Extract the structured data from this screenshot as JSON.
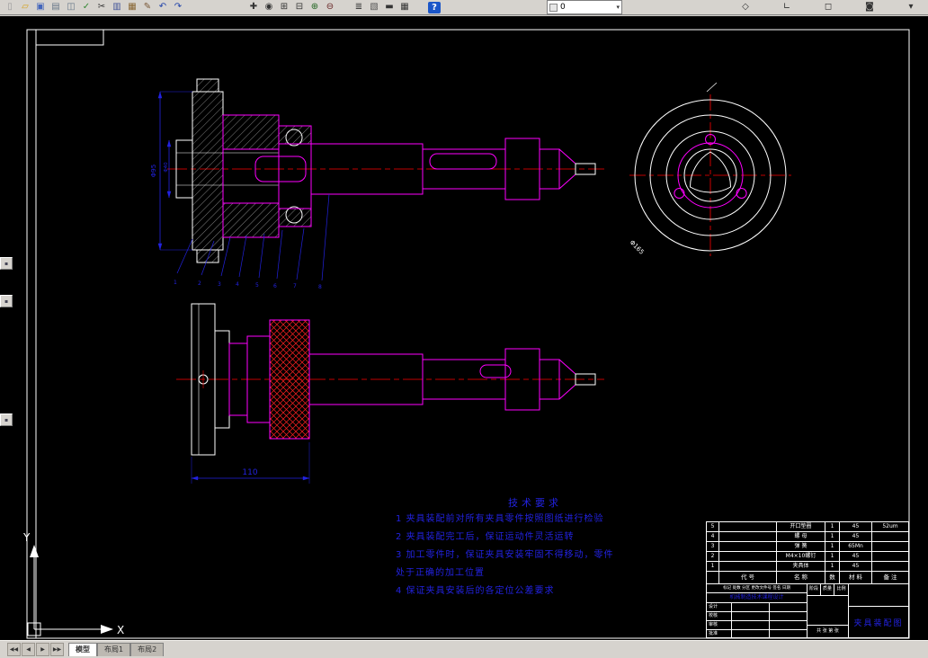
{
  "window": {
    "chrome_bg": "#d6d3ce",
    "canvas_bg": "#000000"
  },
  "colors": {
    "outline": "#ffffff",
    "part_edges": "#ff00ff",
    "centerline": "#ff0000",
    "dimension_blue": "#2222e0",
    "hatch_red": "#ff2020"
  },
  "toolbar": {
    "group1": [
      {
        "name": "new-file-button",
        "glyph": "▯",
        "color": "#9a9a9a"
      },
      {
        "name": "open-file-button",
        "glyph": "▱",
        "color": "#d4a017"
      },
      {
        "name": "save-button",
        "glyph": "▣",
        "color": "#4466bb"
      },
      {
        "name": "plot-button",
        "glyph": "▤",
        "color": "#667788"
      },
      {
        "name": "print-preview-button",
        "glyph": "◫",
        "color": "#667788"
      },
      {
        "name": "spell-check-button",
        "glyph": "✓",
        "color": "#338833"
      },
      {
        "name": "cut-button",
        "glyph": "✂",
        "color": "#333333"
      },
      {
        "name": "copy-button",
        "glyph": "▥",
        "color": "#445599"
      },
      {
        "name": "paste-button",
        "glyph": "▦",
        "color": "#886633"
      },
      {
        "name": "match-properties-button",
        "glyph": "✎",
        "color": "#775533"
      },
      {
        "name": "undo-button",
        "glyph": "↶",
        "color": "#2244aa"
      },
      {
        "name": "redo-button",
        "glyph": "↷",
        "color": "#2244aa"
      }
    ],
    "group2": [
      {
        "name": "pan-button",
        "glyph": "✚",
        "color": "#333333"
      },
      {
        "name": "zoom-realtime-button",
        "glyph": "◉",
        "color": "#333333"
      },
      {
        "name": "zoom-window-button",
        "glyph": "⊞",
        "color": "#333333"
      },
      {
        "name": "zoom-previous-button",
        "glyph": "⊟",
        "color": "#333333"
      },
      {
        "name": "zoom-in-button",
        "glyph": "⊕",
        "color": "#226622"
      },
      {
        "name": "zoom-out-button",
        "glyph": "⊖",
        "color": "#662222"
      }
    ],
    "group3": [
      {
        "name": "layers-button",
        "glyph": "≣",
        "color": "#333333"
      },
      {
        "name": "layer-states-button",
        "glyph": "▧",
        "color": "#555555"
      },
      {
        "name": "linetype-button",
        "glyph": "▬",
        "color": "#333333"
      },
      {
        "name": "table-button",
        "glyph": "▦",
        "color": "#333333"
      }
    ],
    "help": {
      "label": "?"
    },
    "layer_combo": {
      "value": "0"
    },
    "group4": [
      {
        "name": "osnap-button",
        "glyph": "◇",
        "color": "#333333"
      },
      {
        "name": "ucs-button",
        "glyph": "∟",
        "color": "#333333"
      },
      {
        "name": "views-button",
        "glyph": "◻",
        "color": "#333333"
      },
      {
        "name": "render-button",
        "glyph": "◙",
        "color": "#333333"
      },
      {
        "name": "toolbar-overflow-button",
        "glyph": "▾",
        "color": "#333333"
      }
    ],
    "docked_buttons": [
      "▪",
      "▪",
      "▪"
    ]
  },
  "drawing": {
    "dim_flange": "Φ95",
    "dim_spigot": "Φ40",
    "dim_circle": "Φ165",
    "dim_length": "110",
    "balloons": [
      "1",
      "2",
      "3",
      "4",
      "5",
      "6",
      "7",
      "8"
    ]
  },
  "notes": {
    "title": "技术要求",
    "lines": [
      "1  夹具装配前对所有夹具零件按照图纸进行检验",
      "2  夹具装配完工后，保证运动件灵活运转",
      "3  加工零件时，保证夹具安装牢固不得移动，零件",
      "    处于正确的加工位置",
      "4  保证夹具安装后的各定位公差要求"
    ]
  },
  "bom": {
    "header": {
      "no": "",
      "code": "代  号",
      "name": "名  称",
      "qty": "数",
      "mat": "材  料",
      "note": "备 注"
    },
    "rows": [
      {
        "no": "5",
        "code": "",
        "name": "开口垫圈",
        "qty": "1",
        "mat": "45",
        "note": "52um"
      },
      {
        "no": "4",
        "code": "",
        "name": "螺  母",
        "qty": "1",
        "mat": "45",
        "note": ""
      },
      {
        "no": "3",
        "code": "",
        "name": "弹  簧",
        "qty": "1",
        "mat": "65Mn",
        "note": ""
      },
      {
        "no": "2",
        "code": "",
        "name": "M4×10螺钉",
        "qty": "1",
        "mat": "45",
        "note": ""
      },
      {
        "no": "1",
        "code": "",
        "name": "夹具体",
        "qty": "1",
        "mat": "45",
        "note": ""
      }
    ]
  },
  "title_block": {
    "sig_header": "标记 处数 分区 更改文件号 签名 日期",
    "course": "机械制造技术课程设计",
    "row_labels": [
      "设计",
      "校核",
      "审核",
      "批准"
    ],
    "stage_label": "阶段标记",
    "mass_label": "质量",
    "scale_label": "比例",
    "sheet_label": "共 张 第 张",
    "drawing_title": "夹具装配图"
  },
  "status_bar": {
    "nav": [
      "◀◀",
      "◀",
      "▶",
      "▶▶"
    ],
    "tabs": [
      "模型",
      "布局1",
      "布局2"
    ]
  },
  "ucs": {
    "x": "X",
    "y": "Y"
  }
}
